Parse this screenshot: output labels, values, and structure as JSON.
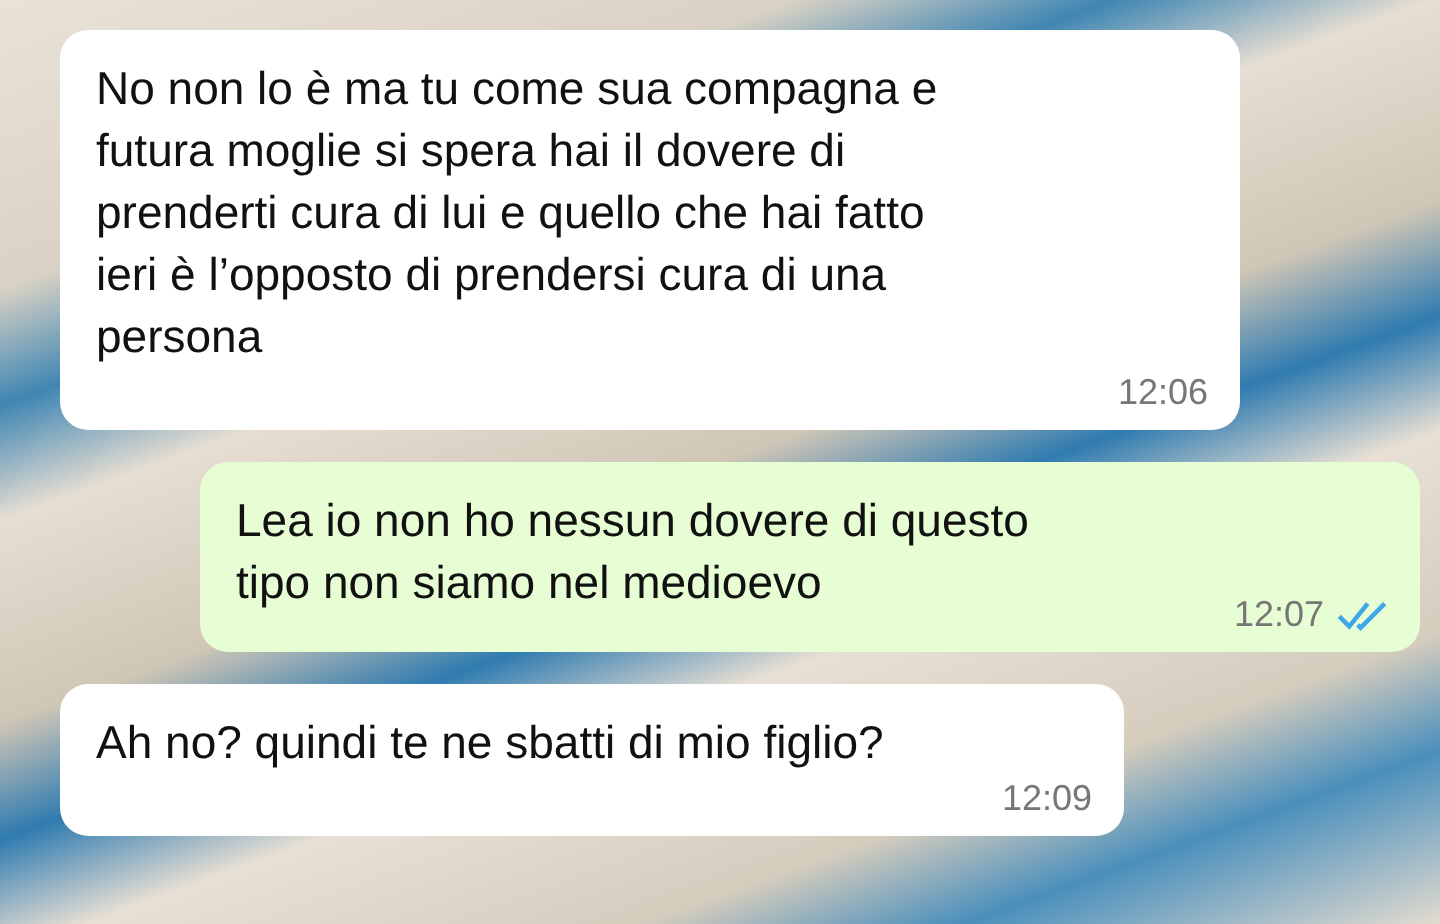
{
  "messages": [
    {
      "kind": "in",
      "lines": [
        "No non lo è ma tu come sua compagna e",
        "futura moglie si spera hai il dovere di",
        "prenderti cura di lui e quello che hai fatto",
        "ieri è l’opposto di prendersi cura di una",
        "persona"
      ],
      "time": "12:06"
    },
    {
      "kind": "out",
      "lines": [
        "Lea io non ho nessun dovere di questo",
        "tipo non siamo nel medioevo"
      ],
      "time": "12:07",
      "read": true
    },
    {
      "kind": "in",
      "lines": [
        "Ah no? quindi te ne sbatti di mio figlio?"
      ],
      "time": "12:09"
    }
  ]
}
